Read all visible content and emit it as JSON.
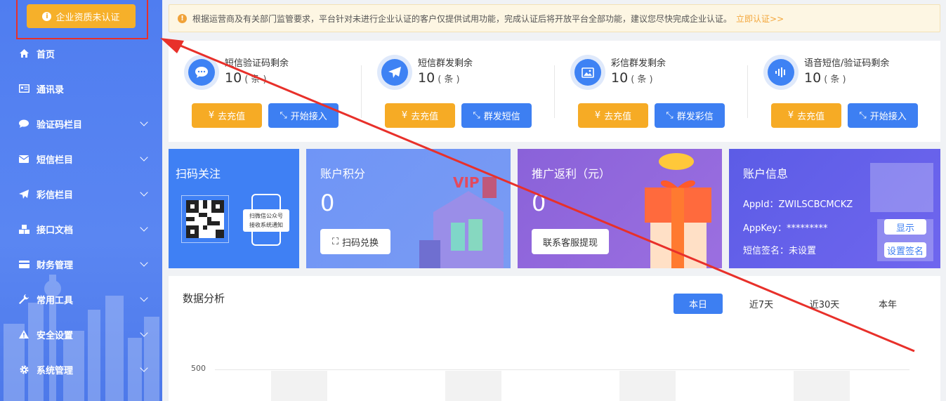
{
  "sidebar": {
    "cert_button": "企业资质未认证",
    "items": [
      {
        "label": "首页",
        "icon": "home-icon",
        "has_submenu": false
      },
      {
        "label": "通讯录",
        "icon": "contacts-icon",
        "has_submenu": false
      },
      {
        "label": "验证码栏目",
        "icon": "chat-icon",
        "has_submenu": true
      },
      {
        "label": "短信栏目",
        "icon": "mail-icon",
        "has_submenu": true
      },
      {
        "label": "彩信栏目",
        "icon": "send-icon",
        "has_submenu": true
      },
      {
        "label": "接口文档",
        "icon": "cubes-icon",
        "has_submenu": true
      },
      {
        "label": "财务管理",
        "icon": "card-icon",
        "has_submenu": true
      },
      {
        "label": "常用工具",
        "icon": "wrench-icon",
        "has_submenu": true
      },
      {
        "label": "安全设置",
        "icon": "warning-icon",
        "has_submenu": true
      },
      {
        "label": "系统管理",
        "icon": "gear-icon",
        "has_submenu": true
      }
    ]
  },
  "notice": {
    "text": "根据运营商及有关部门监管要求，平台针对未进行企业认证的客户仅提供试用功能，完成认证后将开放平台全部功能，建议您尽快完成企业认证。",
    "link": "立即认证>>"
  },
  "stats": [
    {
      "title": "短信验证码剩余",
      "count": "10",
      "unit": "( 条 )",
      "btn1": "去充值",
      "btn2": "开始接入",
      "icon": "chat-bubble-icon"
    },
    {
      "title": "短信群发剩余",
      "count": "10",
      "unit": "( 条 )",
      "btn1": "去充值",
      "btn2": "群发短信",
      "icon": "paper-plane-icon"
    },
    {
      "title": "彩信群发剩余",
      "count": "10",
      "unit": "( 条 )",
      "btn1": "去充值",
      "btn2": "群发彩信",
      "icon": "image-icon"
    },
    {
      "title": "语音短信/验证码剩余",
      "count": "10",
      "unit": "( 条 )",
      "btn1": "去充值",
      "btn2": "开始接入",
      "icon": "voice-icon"
    }
  ],
  "currency_symbol": "¥",
  "cards": {
    "scan": {
      "title": "扫码关注",
      "phone_text": [
        "扫微信公众号",
        "接收系统通知"
      ]
    },
    "points": {
      "title": "账户积分",
      "value": "0",
      "button": "扫码兑换",
      "vip": "VIP"
    },
    "rebate": {
      "title": "推广返利（元）",
      "value": "0",
      "button": "联系客服提现"
    },
    "account": {
      "title": "账户信息",
      "appid_label": "AppId：",
      "appid": "ZWILSCBCMCKZ",
      "appkey_label": "AppKey：",
      "appkey": "*********",
      "sign_label": "短信签名：",
      "sign": "未设置",
      "show_btn": "显示",
      "set_sign_btn": "设置签名"
    }
  },
  "analysis": {
    "title": "数据分析",
    "tabs": [
      "本日",
      "近7天",
      "近30天",
      "本年"
    ],
    "active_tab": 0,
    "y_tick": "500"
  },
  "colors": {
    "sidebar": "#4f7df0",
    "orange": "#f6ab25",
    "blue": "#3d7ff2",
    "annotation": "#e8302a"
  }
}
